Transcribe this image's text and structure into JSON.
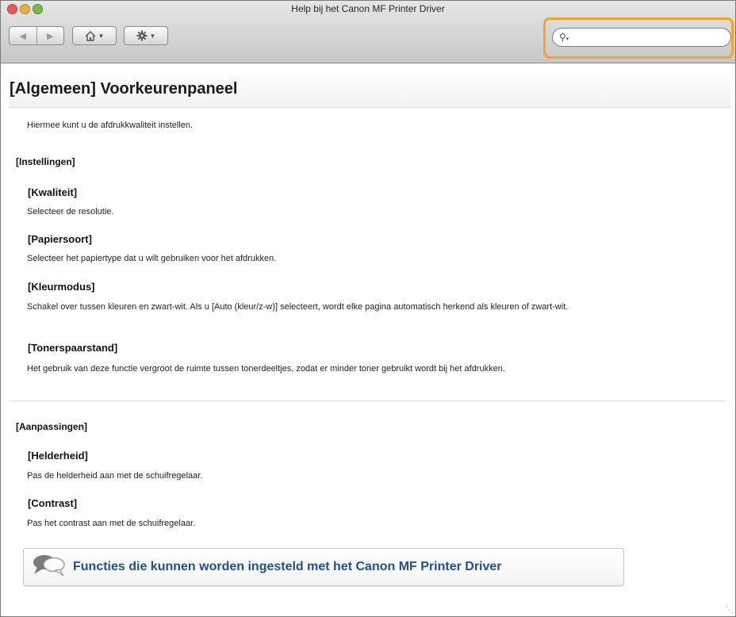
{
  "window": {
    "title": "Help bij het Canon MF Printer Driver"
  },
  "toolbar": {
    "back_icon": "back-arrow-icon",
    "forward_icon": "forward-arrow-icon",
    "home_icon": "home-icon",
    "gear_icon": "gear-icon",
    "search_value": "",
    "search_highlight_color": "#f2a52f"
  },
  "page": {
    "title": "[Algemeen] Voorkeurenpaneel",
    "intro": "Hiermee kunt u de afdrukkwaliteit instellen.",
    "sections": [
      {
        "title": "[Instellingen]",
        "items": [
          {
            "title": "[Kwaliteit]",
            "desc": "Selecteer de resolutie."
          },
          {
            "title": "[Papiersoort]",
            "desc": "Selecteer het papiertype dat u wilt gebruiken voor het afdrukken."
          },
          {
            "title": "[Kleurmodus]",
            "desc": "Schakel over tussen kleuren en zwart-wit. Als u [Auto (kleur/z-w)] selecteert, wordt elke pagina automatisch herkend als kleuren of zwart-wit."
          },
          {
            "title": "[Tonerspaarstand]",
            "desc": "Het gebruik van deze functie vergroot de ruimte tussen tonerdeeltjes, zodat er minder toner gebruikt wordt bij het afdrukken."
          }
        ]
      },
      {
        "title": "[Aanpassingen]",
        "items": [
          {
            "title": "[Helderheid]",
            "desc": "Pas de helderheid aan met de schuifregelaar."
          },
          {
            "title": "[Contrast]",
            "desc": "Pas het contrast aan met de schuifregelaar."
          }
        ]
      }
    ],
    "related_link": "Functies die kunnen worden ingesteld met het Canon MF Printer Driver",
    "related_icon": "speech-bubbles-icon",
    "link_color": "#1f4f92"
  }
}
